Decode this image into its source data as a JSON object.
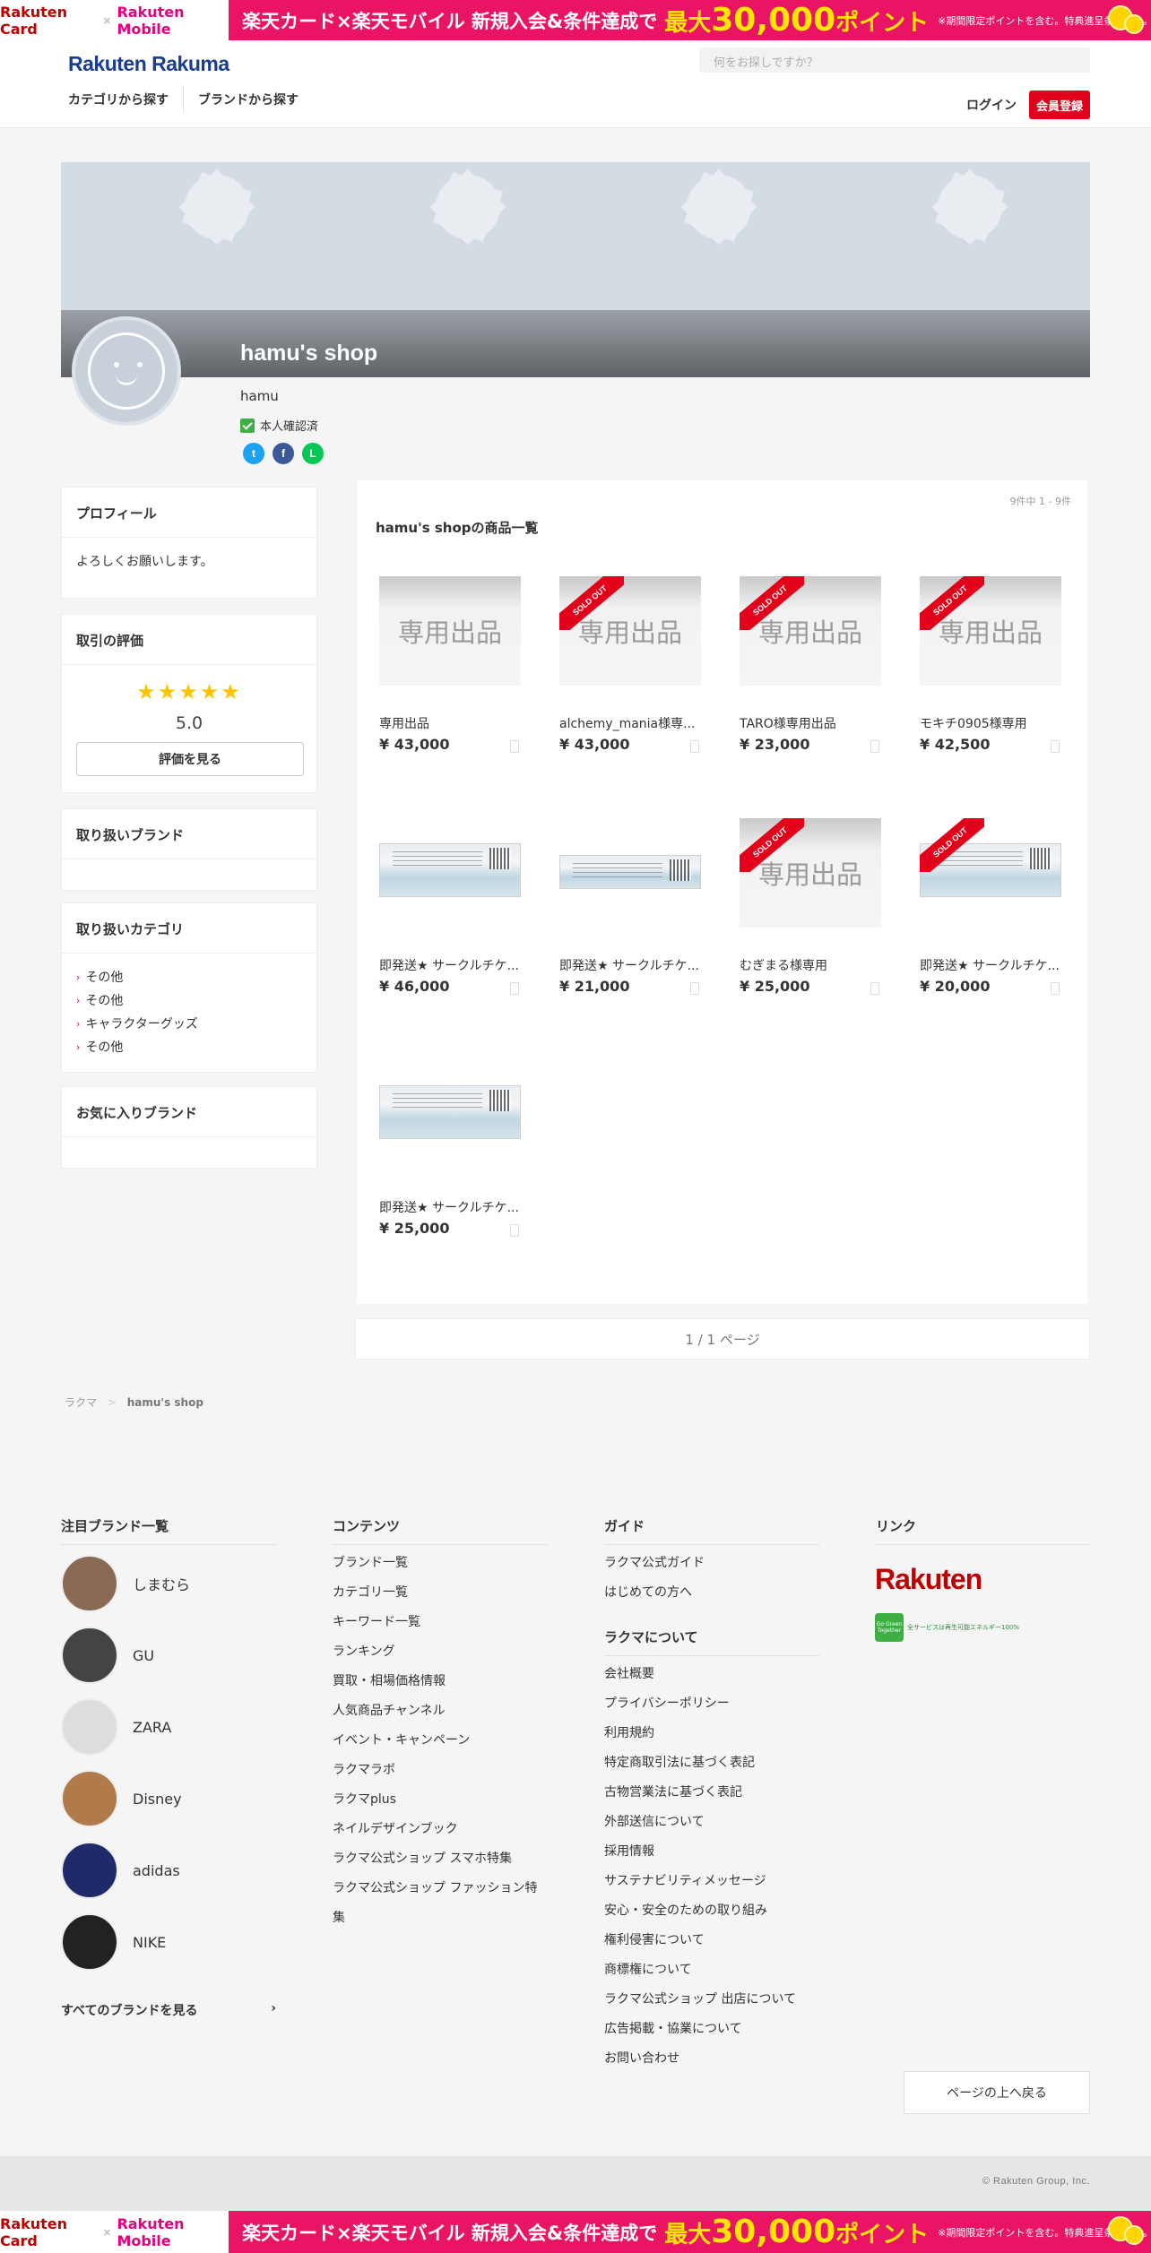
{
  "promo": {
    "card": "Rakuten Card",
    "times": "×",
    "mobile": "Rakuten Mobile",
    "main": "楽天カード×楽天モバイル 新規入会&条件達成で",
    "max_pre": "最大",
    "max_num": "30,000",
    "max_post": "ポイント",
    "note": "※期間限定ポイントを含む。特典進呈条件あり。"
  },
  "header": {
    "logo": "Rakuten Rakuma",
    "search_placeholder": "何をお探しですか？",
    "nav_category": "カテゴリから探す",
    "nav_brand": "ブランドから探す",
    "login": "ログイン",
    "register": "会員登録"
  },
  "shop": {
    "name": "hamu's shop",
    "user": "hamu",
    "verified": "本人確認済",
    "social": [
      "t",
      "f",
      "L"
    ]
  },
  "sidebar": {
    "profile_title": "プロフィール",
    "profile_text": "よろしくお願いします。",
    "rating_title": "取引の評価",
    "stars": "★★★★★",
    "score": "5.0",
    "rating_button": "評価を見る",
    "brands_title": "取り扱いブランド",
    "categories_title": "取り扱いカテゴリ",
    "categories": [
      "その他",
      "その他",
      "キャラクターグッズ",
      "その他"
    ],
    "fav_title": "お気に入りブランド"
  },
  "products": {
    "count": "9件中 1 - 9件",
    "title": "hamu's shopの商品一覧",
    "sold_label": "SOLD OUT",
    "placeholder_text": "専用出品",
    "items": [
      {
        "name": "専用出品",
        "price": "¥ 43,000",
        "sold": false,
        "image": "placeholder"
      },
      {
        "name": "alchemy_mania様専...",
        "price": "¥ 43,000",
        "sold": true,
        "image": "placeholder"
      },
      {
        "name": "TARO様専用出品",
        "price": "¥ 23,000",
        "sold": true,
        "image": "placeholder"
      },
      {
        "name": "モキチ0905様専用",
        "price": "¥ 42,500",
        "sold": true,
        "image": "placeholder"
      },
      {
        "name": "即発送★ サークルチケ...",
        "price": "¥ 46,000",
        "sold": false,
        "image": "ticket"
      },
      {
        "name": "即発送★ サークルチケ...",
        "price": "¥ 21,000",
        "sold": false,
        "image": "ticket"
      },
      {
        "name": "むぎまる様専用",
        "price": "¥ 25,000",
        "sold": true,
        "image": "placeholder"
      },
      {
        "name": "即発送★ サークルチケ...",
        "price": "¥ 20,000",
        "sold": true,
        "image": "ticket"
      },
      {
        "name": "即発送★ サークルチケ...",
        "price": "¥ 25,000",
        "sold": false,
        "image": "ticket"
      }
    ],
    "pager": "1 / 1 ページ"
  },
  "breadcrumb": {
    "home": "ラクマ",
    "sep": ">",
    "current": "hamu's shop"
  },
  "footer": {
    "brands_title": "注目ブランド一覧",
    "brands": [
      "しまむら",
      "GU",
      "ZARA",
      "Disney",
      "adidas",
      "NIKE"
    ],
    "all_brands": "すべてのブランドを見る",
    "contents_title": "コンテンツ",
    "contents": [
      "ブランド一覧",
      "カテゴリ一覧",
      "キーワード一覧",
      "ランキング",
      "買取・相場価格情報",
      "人気商品チャンネル",
      "イベント・キャンペーン",
      "ラクマラボ",
      "ラクマplus",
      "ネイルデザインブック",
      "ラクマ公式ショップ スマホ特集",
      "ラクマ公式ショップ ファッション特集"
    ],
    "guide_title": "ガイド",
    "guide": [
      "ラクマ公式ガイド",
      "はじめての方へ"
    ],
    "about_title": "ラクマについて",
    "about": [
      "会社概要",
      "プライバシーポリシー",
      "利用規約",
      "特定商取引法に基づく表記",
      "古物営業法に基づく表記",
      "外部送信について",
      "採用情報",
      "サステナビリティメッセージ",
      "安心・安全のための取り組み",
      "権利侵害について",
      "商標権について",
      "ラクマ公式ショップ 出店について",
      "広告掲載・協業について",
      "お問い合わせ"
    ],
    "links_title": "リンク",
    "rakuten_logo": "Rakuten",
    "green_label": "Go Green Together",
    "green_text": "全サービスは再生可能エネルギー100%",
    "to_top": "ページの上へ戻る",
    "copyright": "© Rakuten Group, Inc."
  },
  "colors": {
    "accent": "#e3001b",
    "promo": "#ea1464",
    "brand_blue": "#1a3d8f"
  }
}
